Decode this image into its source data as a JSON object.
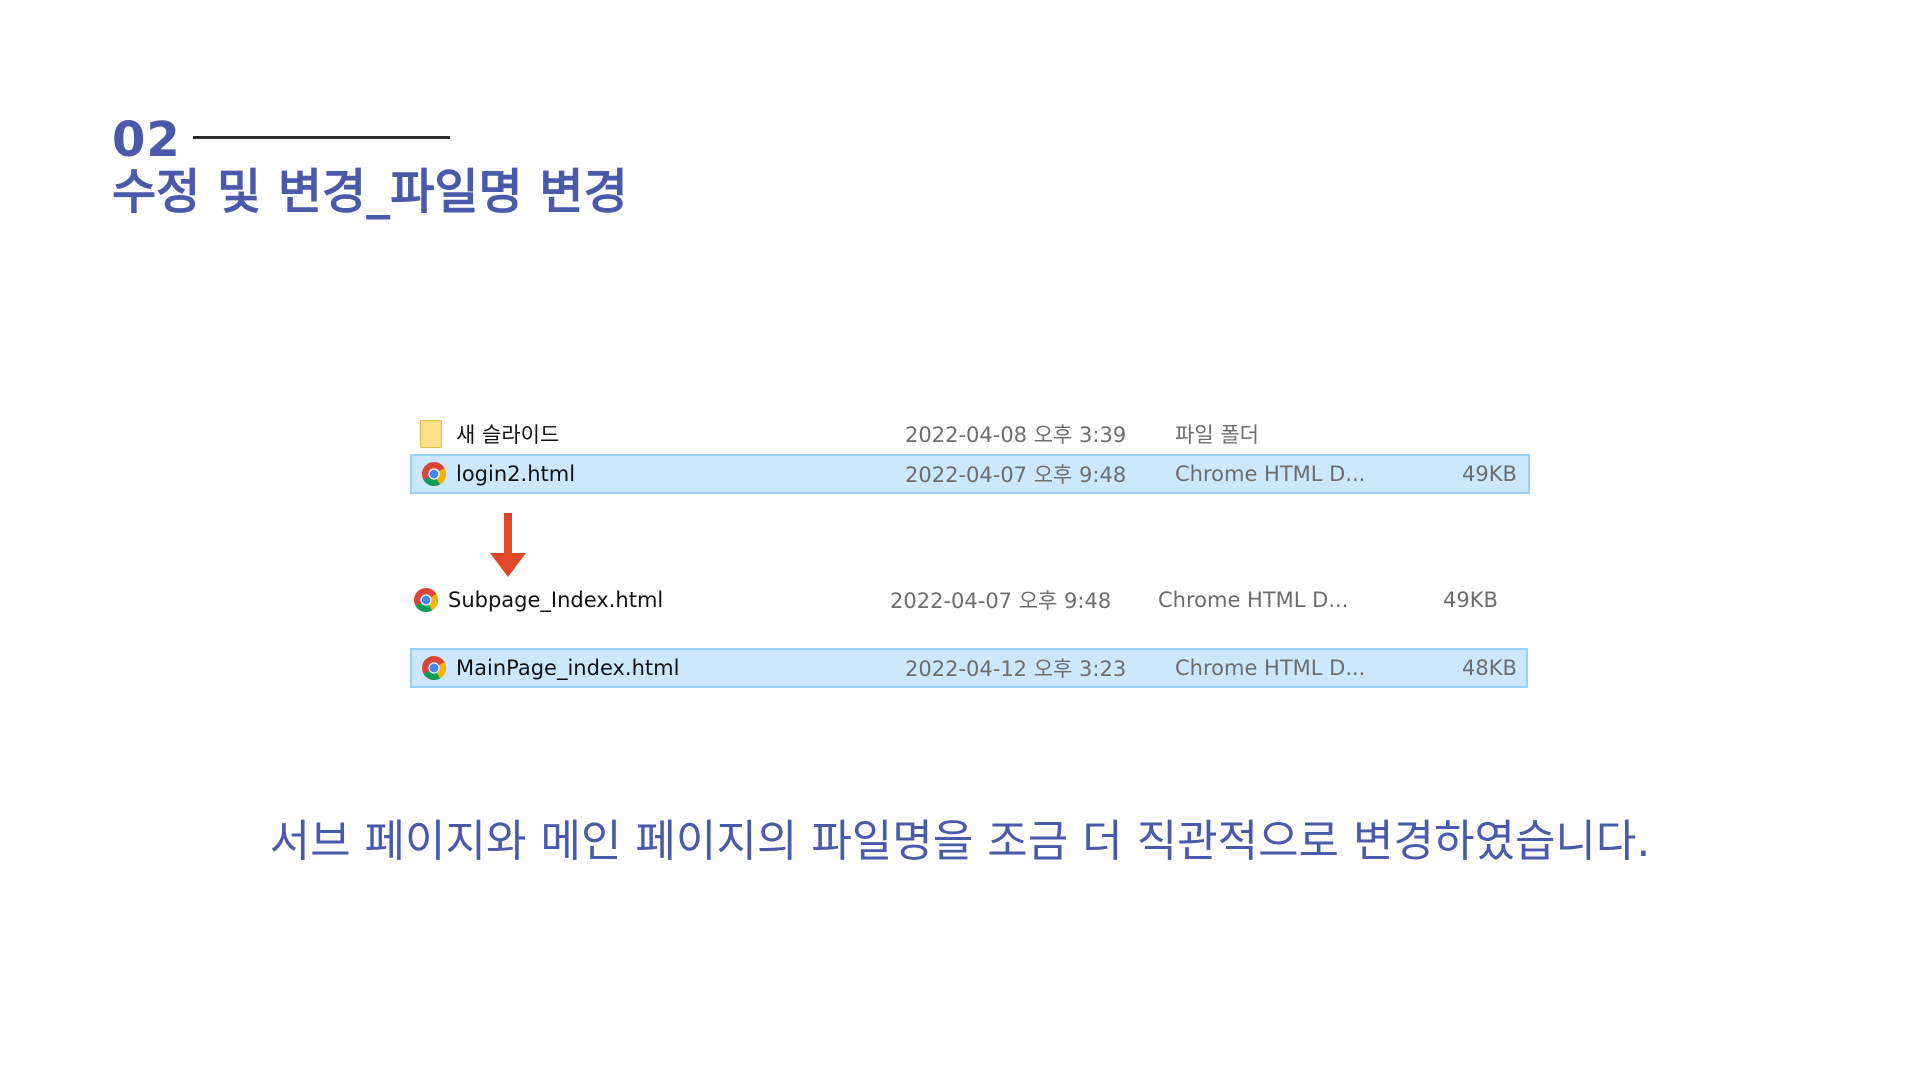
{
  "header": {
    "section_number": "02",
    "title": "수정 및 변경_파일명 변경"
  },
  "files": [
    {
      "name": "새 슬라이드",
      "modified": "2022-04-08 오후 3:39",
      "type": "파일 폴더",
      "size": "",
      "icon": "folder-icon",
      "selected": false
    },
    {
      "name": "login2.html",
      "modified": "2022-04-07 오후 9:48",
      "type": "Chrome HTML D...",
      "size": "49KB",
      "icon": "chrome-icon",
      "selected": true
    },
    {
      "name": "Subpage_Index.html",
      "modified": "2022-04-07 오후 9:48",
      "type": "Chrome HTML D...",
      "size": "49KB",
      "icon": "chrome-icon",
      "selected": false
    },
    {
      "name": "MainPage_index.html",
      "modified": "2022-04-12 오후 3:23",
      "type": "Chrome HTML D...",
      "size": "48KB",
      "icon": "chrome-icon",
      "selected": true
    }
  ],
  "arrow_icon": "down-arrow-icon",
  "caption": "서브 페이지와 메인 페이지의 파일명을 조금 더 직관적으로 변경하였습니다.",
  "colors": {
    "accent": "#4a5aaa",
    "selection_bg": "#cce8ff",
    "selection_border": "#99d1ff",
    "arrow": "#e0482a"
  }
}
